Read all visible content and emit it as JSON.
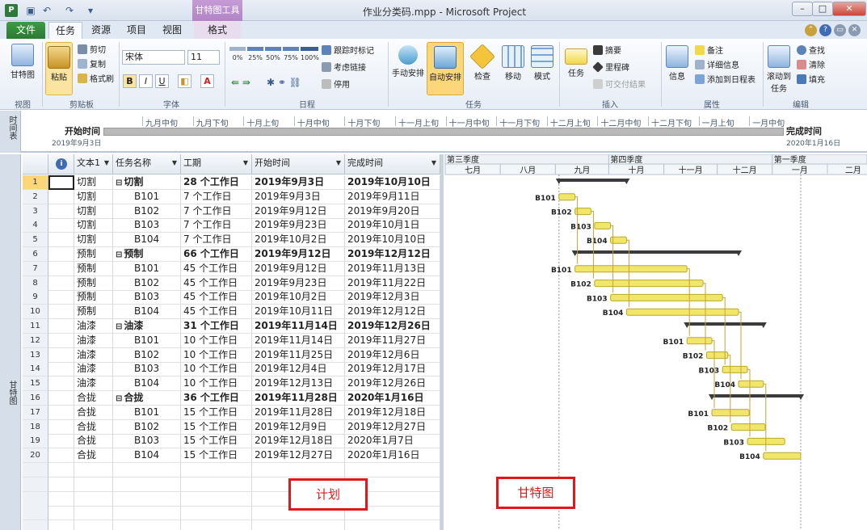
{
  "window": {
    "title": "作业分类码.mpp - Microsoft Project",
    "tool_context_tab": "甘特图工具",
    "app_icon": "P",
    "minimize": "–",
    "maximize": "□",
    "close": "✕"
  },
  "tabs": [
    "文件",
    "任务",
    "资源",
    "项目",
    "视图",
    "格式"
  ],
  "ribbon": {
    "view_group": {
      "label": "视图",
      "gantt": "甘特图"
    },
    "clipboard": {
      "label": "剪贴板",
      "paste": "粘贴",
      "cut": "剪切",
      "copy": "复制",
      "format_painter": "格式刷"
    },
    "font": {
      "label": "字体",
      "family": "宋体",
      "size": "11",
      "bold": "B",
      "italic": "I",
      "underline": "U"
    },
    "schedule": {
      "label": "日程",
      "mark_on_track": "跟踪时标记",
      "respect_links": "考虑链接",
      "inactivate": "停用",
      "percents": [
        "0%",
        "25%",
        "50%",
        "75%",
        "100%"
      ]
    },
    "tasks": {
      "label": "任务",
      "manual": "手动安排",
      "auto": "自动安排",
      "inspect": "检查",
      "move": "移动",
      "mode": "模式"
    },
    "insert": {
      "label": "插入",
      "task": "任务",
      "summary": "摘要",
      "milestone": "里程碑",
      "deliverable": "可交付结果"
    },
    "properties": {
      "label": "属性",
      "info": "信息",
      "notes": "备注",
      "details": "详细信息",
      "add_to_timeline": "添加到日程表"
    },
    "editing": {
      "label": "编辑",
      "scroll_to_task": "滚动到任务",
      "find": "查找",
      "clear": "清除",
      "fill": "填充"
    }
  },
  "timeline": {
    "side_label": "时间表",
    "start_label": "开始时间",
    "start_date": "2019年9月3日",
    "finish_label": "完成时间",
    "finish_date": "2020年1月16日",
    "periods": [
      "九月中旬",
      "九月下旬",
      "十月上旬",
      "十月中旬",
      "十月下旬",
      "十一月上旬",
      "十一月中旬",
      "十一月下旬",
      "十二月上旬",
      "十二月中旬",
      "十二月下旬",
      "一月上旬",
      "一月中旬"
    ]
  },
  "side_gantt_label": "甘特图",
  "grid": {
    "headers": [
      "",
      "文本1",
      "任务名称",
      "工期",
      "开始时间",
      "完成时间"
    ],
    "rows": [
      {
        "n": "1",
        "text1": "切割",
        "name": "切割",
        "dur": "28 个工作日",
        "start": "2019年9月3日",
        "finish": "2019年10月10日",
        "summary": true
      },
      {
        "n": "2",
        "text1": "切割",
        "name": "B101",
        "dur": "7 个工作日",
        "start": "2019年9月3日",
        "finish": "2019年9月11日",
        "summary": false
      },
      {
        "n": "3",
        "text1": "切割",
        "name": "B102",
        "dur": "7 个工作日",
        "start": "2019年9月12日",
        "finish": "2019年9月20日",
        "summary": false
      },
      {
        "n": "4",
        "text1": "切割",
        "name": "B103",
        "dur": "7 个工作日",
        "start": "2019年9月23日",
        "finish": "2019年10月1日",
        "summary": false
      },
      {
        "n": "5",
        "text1": "切割",
        "name": "B104",
        "dur": "7 个工作日",
        "start": "2019年10月2日",
        "finish": "2019年10月10日",
        "summary": false
      },
      {
        "n": "6",
        "text1": "预制",
        "name": "预制",
        "dur": "66 个工作日",
        "start": "2019年9月12日",
        "finish": "2019年12月12日",
        "summary": true
      },
      {
        "n": "7",
        "text1": "预制",
        "name": "B101",
        "dur": "45 个工作日",
        "start": "2019年9月12日",
        "finish": "2019年11月13日",
        "summary": false
      },
      {
        "n": "8",
        "text1": "预制",
        "name": "B102",
        "dur": "45 个工作日",
        "start": "2019年9月23日",
        "finish": "2019年11月22日",
        "summary": false
      },
      {
        "n": "9",
        "text1": "预制",
        "name": "B103",
        "dur": "45 个工作日",
        "start": "2019年10月2日",
        "finish": "2019年12月3日",
        "summary": false
      },
      {
        "n": "10",
        "text1": "预制",
        "name": "B104",
        "dur": "45 个工作日",
        "start": "2019年10月11日",
        "finish": "2019年12月12日",
        "summary": false
      },
      {
        "n": "11",
        "text1": "油漆",
        "name": "油漆",
        "dur": "31 个工作日",
        "start": "2019年11月14日",
        "finish": "2019年12月26日",
        "summary": true
      },
      {
        "n": "12",
        "text1": "油漆",
        "name": "B101",
        "dur": "10 个工作日",
        "start": "2019年11月14日",
        "finish": "2019年11月27日",
        "summary": false
      },
      {
        "n": "13",
        "text1": "油漆",
        "name": "B102",
        "dur": "10 个工作日",
        "start": "2019年11月25日",
        "finish": "2019年12月6日",
        "summary": false
      },
      {
        "n": "14",
        "text1": "油漆",
        "name": "B103",
        "dur": "10 个工作日",
        "start": "2019年12月4日",
        "finish": "2019年12月17日",
        "summary": false
      },
      {
        "n": "15",
        "text1": "油漆",
        "name": "B104",
        "dur": "10 个工作日",
        "start": "2019年12月13日",
        "finish": "2019年12月26日",
        "summary": false
      },
      {
        "n": "16",
        "text1": "合拢",
        "name": "合拢",
        "dur": "36 个工作日",
        "start": "2019年11月28日",
        "finish": "2020年1月16日",
        "summary": true
      },
      {
        "n": "17",
        "text1": "合拢",
        "name": "B101",
        "dur": "15 个工作日",
        "start": "2019年11月28日",
        "finish": "2019年12月18日",
        "summary": false
      },
      {
        "n": "18",
        "text1": "合拢",
        "name": "B102",
        "dur": "15 个工作日",
        "start": "2019年12月9日",
        "finish": "2019年12月27日",
        "summary": false
      },
      {
        "n": "19",
        "text1": "合拢",
        "name": "B103",
        "dur": "15 个工作日",
        "start": "2019年12月18日",
        "finish": "2020年1月7日",
        "summary": false
      },
      {
        "n": "20",
        "text1": "合拢",
        "name": "B104",
        "dur": "15 个工作日",
        "start": "2019年12月27日",
        "finish": "2020年1月16日",
        "summary": false
      }
    ]
  },
  "gantt": {
    "quarters": [
      "第三季度",
      "第四季度",
      "第一季度"
    ],
    "months": [
      "七月",
      "八月",
      "九月",
      "十月",
      "十一月",
      "十二月",
      "一月",
      "二月"
    ]
  },
  "annotations": {
    "plan": "计划",
    "gantt": "甘特图"
  },
  "colors": {
    "bar": "#f1e66a",
    "summary": "#3b3b3b",
    "accent": "#2c7a33",
    "annotation": "#e0181b"
  }
}
